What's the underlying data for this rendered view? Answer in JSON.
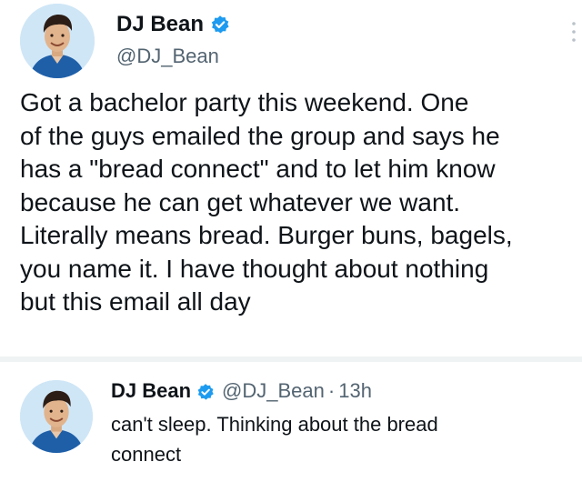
{
  "main_tweet": {
    "display_name": "DJ Bean",
    "handle": "@DJ_Bean",
    "text_lines": [
      "Got a bachelor party this weekend. One",
      "of the guys emailed the group and says he",
      "has a \"bread connect\" and to let him know",
      "because he can get whatever we want.",
      "Literally means bread. Burger buns, bagels,",
      "you name it. I have thought about nothing",
      "but this email all day"
    ],
    "icons": {
      "verified": "verified-badge-icon",
      "more": "more-options-icon",
      "avatar": "profile-avatar"
    }
  },
  "reply_tweet": {
    "display_name": "DJ Bean",
    "handle": "@DJ_Bean",
    "separator": "·",
    "time": "13h",
    "text_lines": [
      "can't sleep. Thinking about the bread",
      "connect"
    ]
  },
  "colors": {
    "verified_blue": "#1d9bf0",
    "text_primary": "#0f1419",
    "text_secondary": "#536471",
    "divider": "#eff3f4",
    "avatar_bg": "#cfe6f6"
  }
}
